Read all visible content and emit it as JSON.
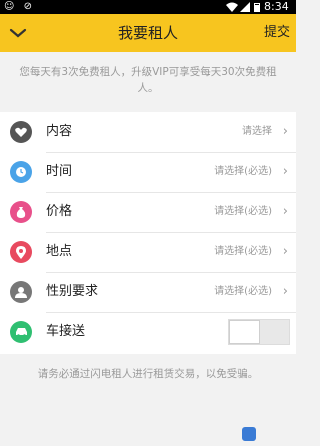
{
  "status_bar": {
    "left_icons": "☺ ⊘",
    "time": "8:34"
  },
  "header": {
    "title": "我要租人",
    "submit_label": "提交"
  },
  "notice": "您每天有3次免费租人，升级VIP可享受每天30次免费租人。",
  "rows": [
    {
      "label": "内容",
      "value": "请选择",
      "icon": "heart-icon",
      "color": "#555555"
    },
    {
      "label": "时间",
      "value": "请选择(必选)",
      "icon": "clock-icon",
      "color": "#4aa3e8"
    },
    {
      "label": "价格",
      "value": "请选择(必选)",
      "icon": "money-bag-icon",
      "color": "#e8508a"
    },
    {
      "label": "地点",
      "value": "请选择(必选)",
      "icon": "location-pin-icon",
      "color": "#e84a5f"
    },
    {
      "label": "性别要求",
      "value": "请选择(必选)",
      "icon": "person-icon",
      "color": "#777777"
    },
    {
      "label": "车接送",
      "toggle": "off",
      "icon": "car-icon",
      "color": "#2fbf71"
    }
  ],
  "footer_note": "请务必通过闪电租人进行租赁交易，以免受骗。",
  "colors": {
    "accent": "#f7c51f",
    "background": "#f2f2f2"
  }
}
